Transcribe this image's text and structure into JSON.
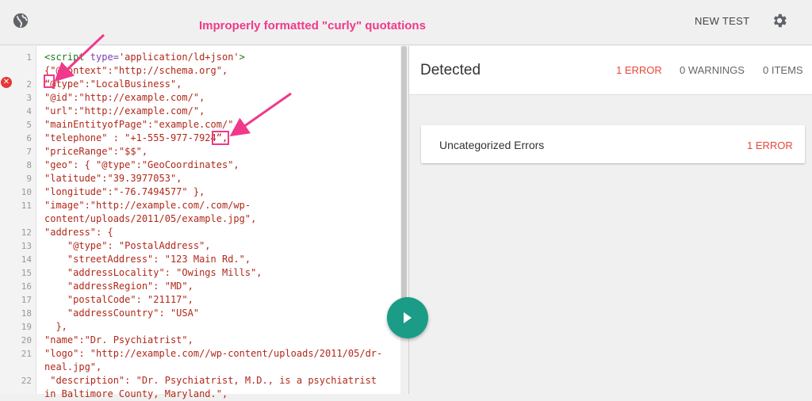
{
  "header": {
    "annotation": "Improperly formatted \"curly\" quotations",
    "new_test_label": "NEW TEST",
    "icons": {
      "left": "globe-icon",
      "right": "gear-icon"
    }
  },
  "editor": {
    "error_icon": "error-icon",
    "lines": [
      {
        "n": "1",
        "text": "<script type='application/ld+json'>"
      },
      {
        "n": "",
        "text": "{\"@context\":\"http://schema.org\","
      },
      {
        "n": "2",
        "text": "“@type\":\"LocalBusiness\","
      },
      {
        "n": "3",
        "text": "\"@id\":\"http://example.com/\","
      },
      {
        "n": "4",
        "text": "\"url\":\"http://example.com/\","
      },
      {
        "n": "5",
        "text": "\"mainEntityofPage\":\"example.com/\","
      },
      {
        "n": "6",
        "text": "\"telephone\" : \"+1-555-977-7924”,"
      },
      {
        "n": "7",
        "text": "\"priceRange\":\"$$\","
      },
      {
        "n": "8",
        "text": "\"geo\": { \"@type\":\"GeoCoordinates\","
      },
      {
        "n": "9",
        "text": "\"latitude\":\"39.3977053\","
      },
      {
        "n": "10",
        "text": "\"longitude\":\"-76.7494577\" },"
      },
      {
        "n": "11",
        "text": "\"image\":\"http://example.com/.com/wp-"
      },
      {
        "n": "",
        "text": "content/uploads/2011/05/example.jpg\","
      },
      {
        "n": "12",
        "text": "\"address\": {"
      },
      {
        "n": "13",
        "text": "    \"@type\": \"PostalAddress\","
      },
      {
        "n": "14",
        "text": "    \"streetAddress\": \"123 Main Rd.\","
      },
      {
        "n": "15",
        "text": "    \"addressLocality\": \"Owings Mills\","
      },
      {
        "n": "16",
        "text": "    \"addressRegion\": \"MD\","
      },
      {
        "n": "17",
        "text": "    \"postalCode\": \"21117\","
      },
      {
        "n": "18",
        "text": "    \"addressCountry\": \"USA\""
      },
      {
        "n": "19",
        "text": "  },"
      },
      {
        "n": "20",
        "text": "\"name\":\"Dr. Psychiatrist\","
      },
      {
        "n": "21",
        "text": "\"logo\": \"http://example.com//wp-content/uploads/2011/05/dr-"
      },
      {
        "n": "",
        "text": "neal.jpg\","
      },
      {
        "n": "22",
        "text": " \"description\": \"Dr. Psychiatrist, M.D., is a psychiatrist"
      },
      {
        "n": "",
        "text": "in Baltimore County, Maryland.\","
      }
    ]
  },
  "results": {
    "title": "Detected",
    "errors": "1 ERROR",
    "warnings": "0 WARNINGS",
    "items": "0 ITEMS",
    "card": {
      "title": "Uncategorized Errors",
      "count": "1 ERROR"
    }
  },
  "run_button": {
    "icon": "play-icon"
  },
  "colors": {
    "accent_pink": "#f0398a",
    "error_red": "#e8463a",
    "run_teal": "#1a9c87"
  }
}
